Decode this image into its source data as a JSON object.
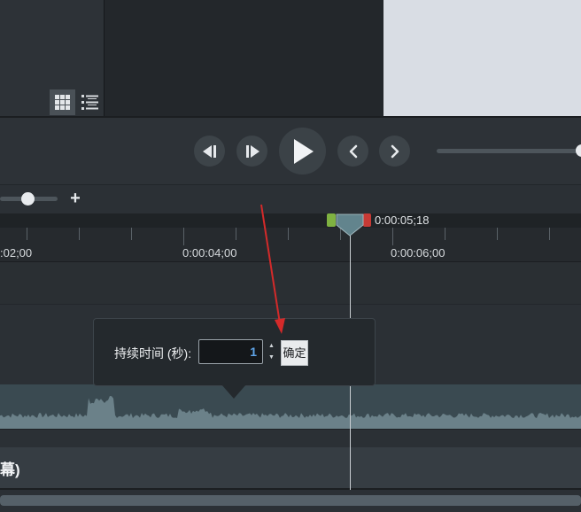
{
  "timeline": {
    "ruler_labels": [
      ":02;00",
      "0:00:04;00",
      "0:00:06;00"
    ],
    "playhead_time": "0:00:05;18",
    "caption_track_label": "幕)"
  },
  "duration_popup": {
    "label": "持续时间 (秒):",
    "value": "1",
    "confirm_label": "确定"
  },
  "colors": {
    "accent_blue": "#5fa4e8",
    "in_handle": "#7fb241",
    "out_handle": "#c73a35",
    "annotation_arrow": "#d42a2a"
  },
  "icons": {
    "grid_view": "grid-view-icon",
    "list_view": "list-view-icon",
    "step_back": "step-back-icon",
    "step_forward": "step-forward-icon",
    "play": "play-icon",
    "prev": "chevron-left-icon",
    "next": "chevron-right-icon",
    "zoom_in": "plus-icon"
  }
}
